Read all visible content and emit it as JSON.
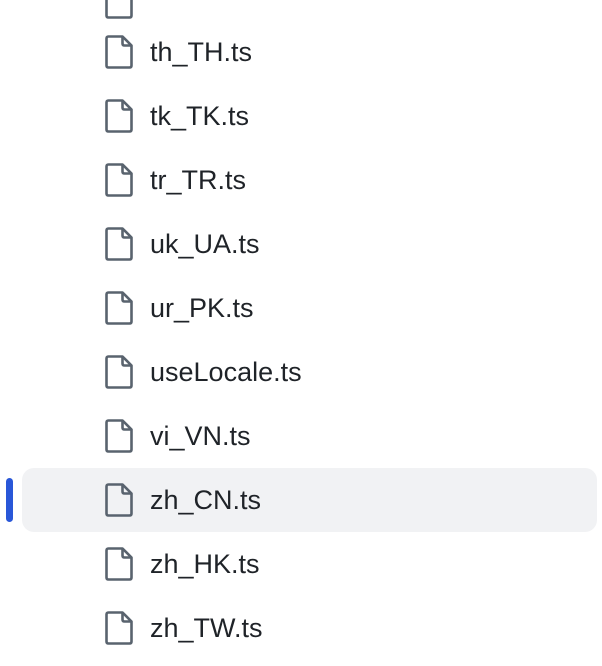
{
  "file_tree": {
    "partial_item": {
      "label": "",
      "icon": "file-icon"
    },
    "items": [
      {
        "label": "th_TH.ts",
        "icon": "file-icon",
        "selected": false
      },
      {
        "label": "tk_TK.ts",
        "icon": "file-icon",
        "selected": false
      },
      {
        "label": "tr_TR.ts",
        "icon": "file-icon",
        "selected": false
      },
      {
        "label": "uk_UA.ts",
        "icon": "file-icon",
        "selected": false
      },
      {
        "label": "ur_PK.ts",
        "icon": "file-icon",
        "selected": false
      },
      {
        "label": "useLocale.ts",
        "icon": "file-icon",
        "selected": false
      },
      {
        "label": "vi_VN.ts",
        "icon": "file-icon",
        "selected": false
      },
      {
        "label": "zh_CN.ts",
        "icon": "file-icon",
        "selected": true
      },
      {
        "label": "zh_HK.ts",
        "icon": "file-icon",
        "selected": false
      },
      {
        "label": "zh_TW.ts",
        "icon": "file-icon",
        "selected": false
      }
    ]
  },
  "colors": {
    "selected_background": "#f1f2f4",
    "selected_indicator": "#2957d8",
    "text": "#1f2328",
    "icon_stroke": "#59636e"
  }
}
